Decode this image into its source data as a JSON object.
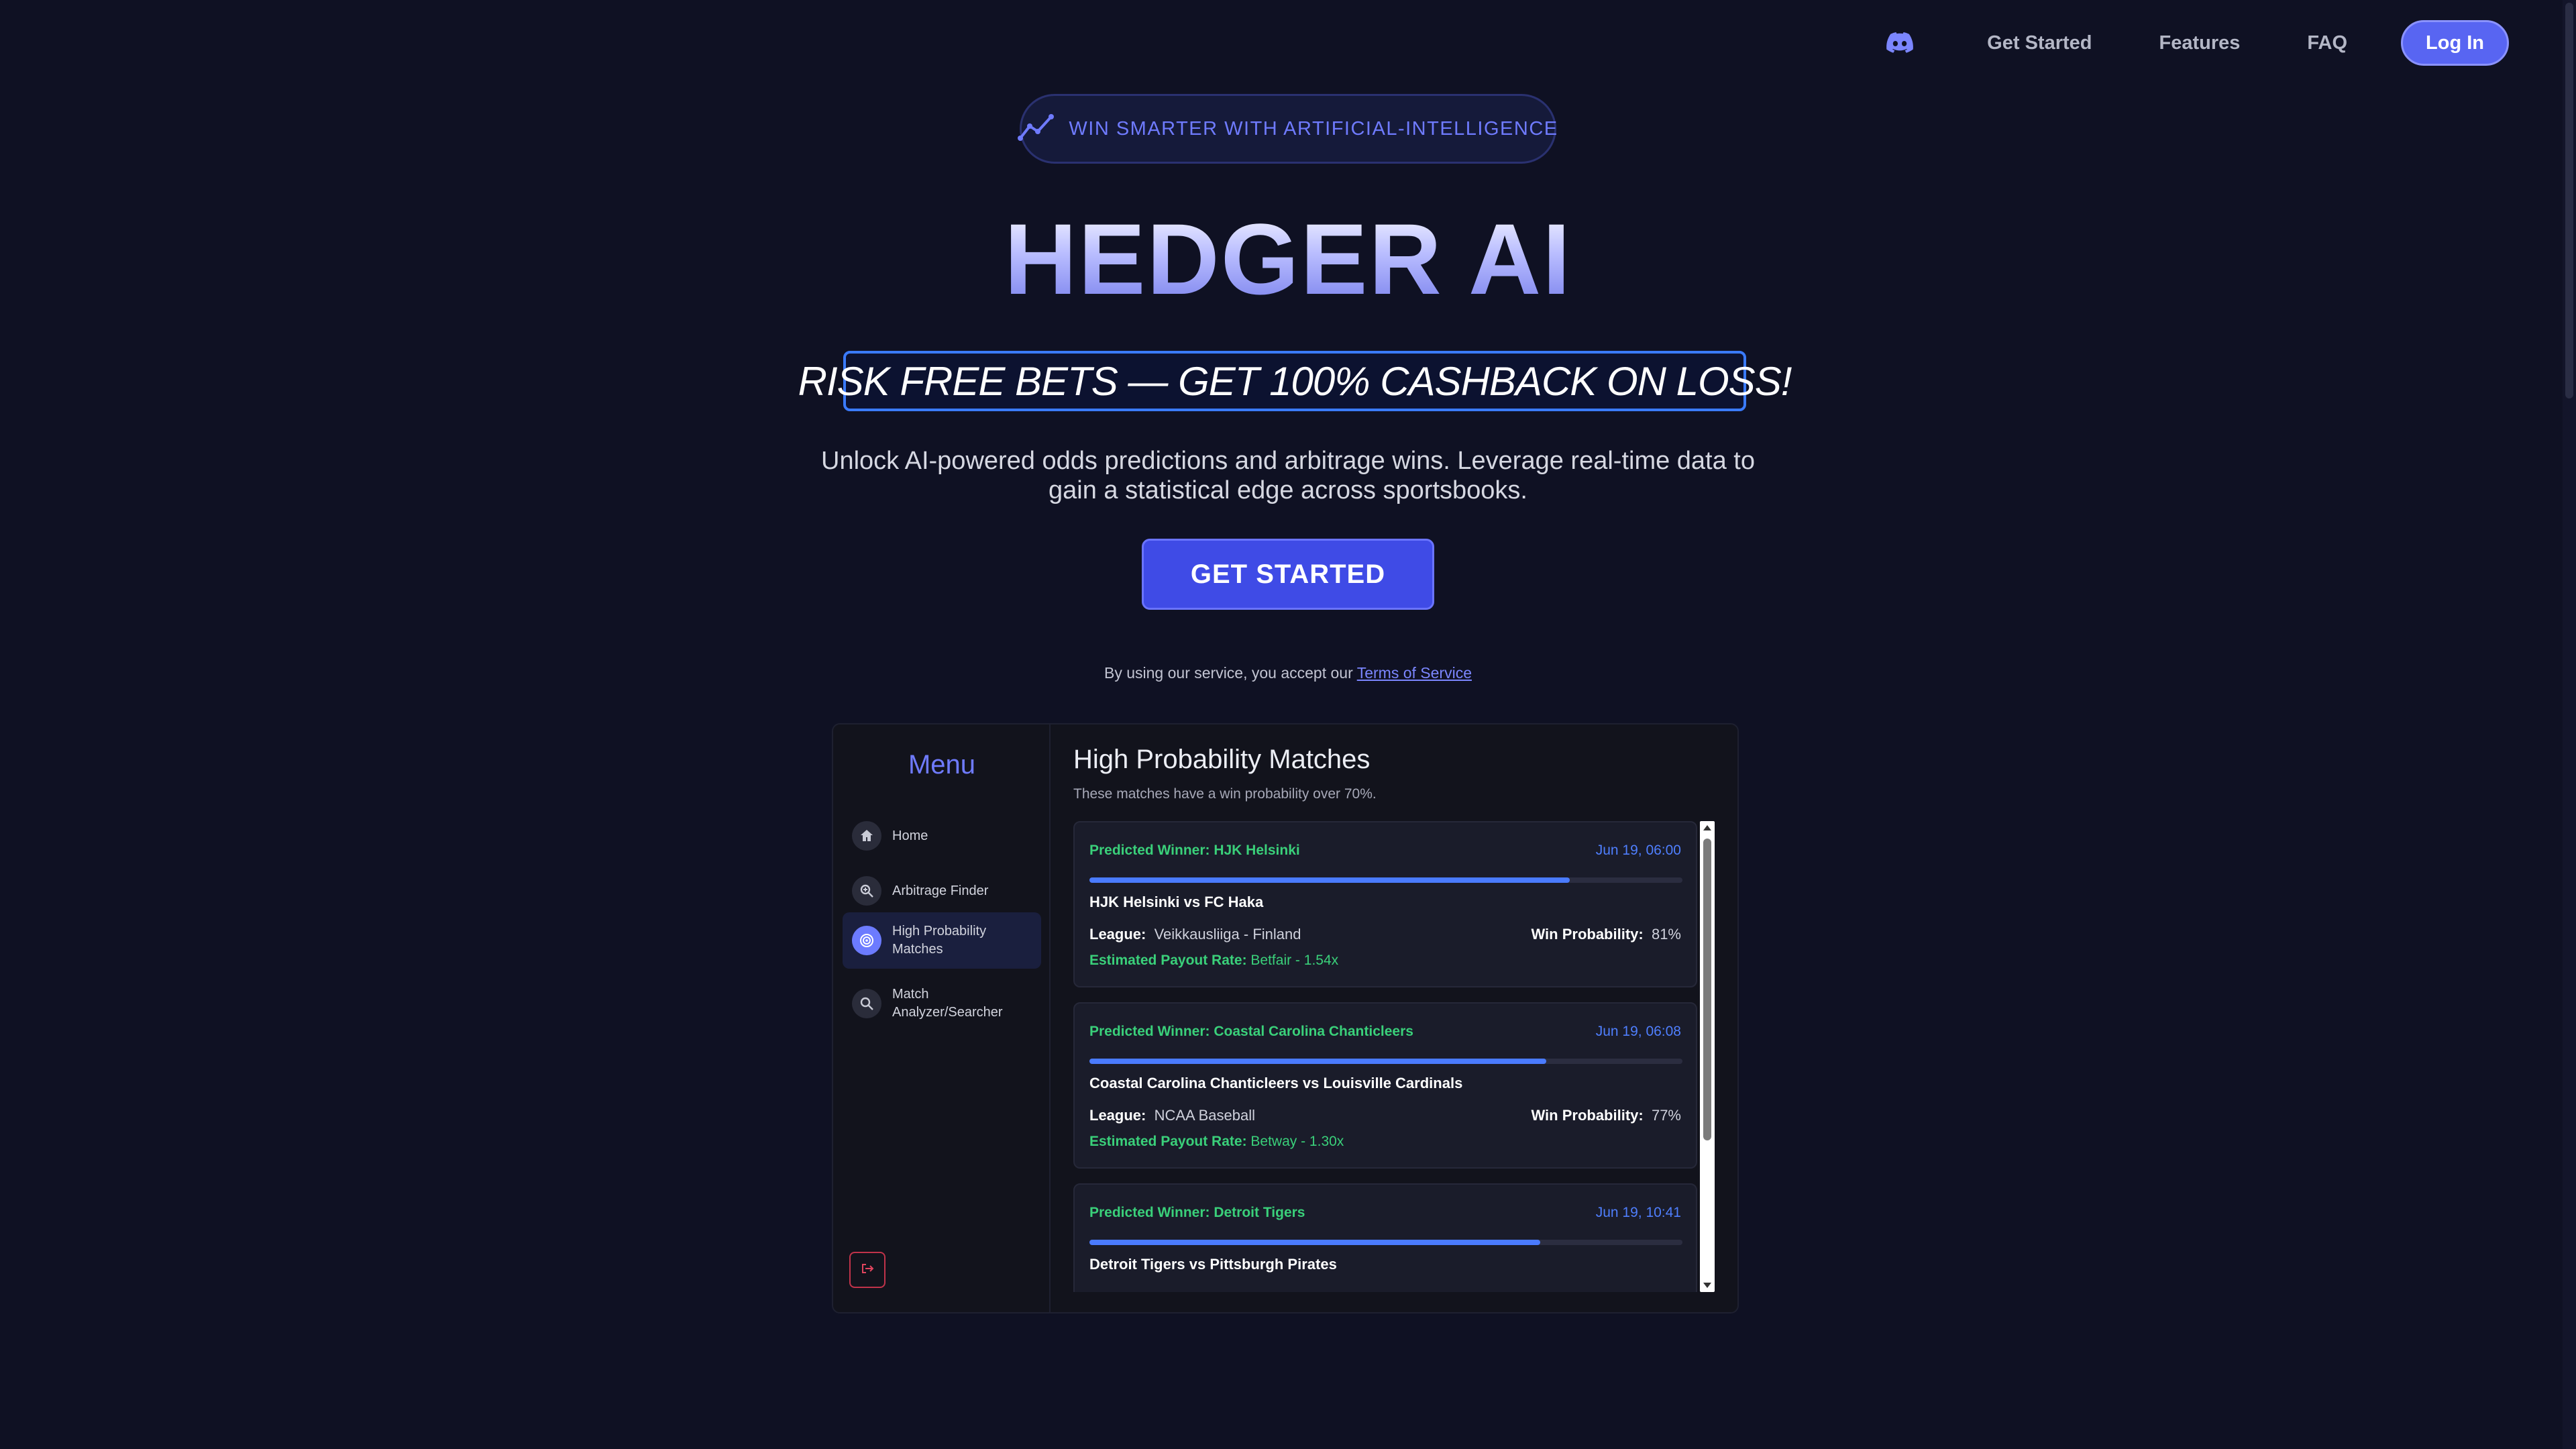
{
  "nav": {
    "discord_icon": "discord-icon",
    "items": [
      "Get Started",
      "Features",
      "FAQ"
    ],
    "login_label": "Log In"
  },
  "hero": {
    "badge_icon": "trend-line-icon",
    "badge_text": "WIN SMARTER WITH ARTIFICIAL-INTELLIGENCE",
    "title": "HEDGER AI",
    "risk_banner": "RISK FREE BETS — GET 100% CASHBACK ON LOSS!",
    "subtitle": "Unlock AI-powered odds predictions and arbitrage wins. Leverage real-time data to gain a statistical edge across sportsbooks.",
    "cta_label": "GET STARTED",
    "tos_prefix": "By using our service, you accept our ",
    "tos_link": "Terms of Service"
  },
  "preview": {
    "menu_title": "Menu",
    "menu_items": [
      {
        "label": "Home",
        "icon": "home-icon"
      },
      {
        "label": "Arbitrage Finder",
        "icon": "magnify-plus-icon"
      },
      {
        "label": "High Probability Matches",
        "icon": "target-icon",
        "active": true
      },
      {
        "label": "Match Analyzer/Searcher",
        "icon": "search-icon"
      }
    ],
    "logout_icon": "logout-icon",
    "heading": "High Probability Matches",
    "subheading": "These matches have a win probability over 70%.",
    "labels": {
      "league": "League:",
      "win_prob": "Win Probability:",
      "payout": "Estimated Payout Rate:"
    },
    "matches": [
      {
        "winner": "Predicted Winner: HJK Helsinki",
        "date": "Jun 19, 06:00",
        "progress": 0.81,
        "match": "HJK Helsinki vs FC Haka",
        "league": "Veikkausliiga - Finland",
        "win_prob": "81%",
        "payout": "Betfair - 1.54x"
      },
      {
        "winner": "Predicted Winner: Coastal Carolina Chanticleers",
        "date": "Jun 19, 06:08",
        "progress": 0.77,
        "match": "Coastal Carolina Chanticleers vs Louisville Cardinals",
        "league": "NCAA Baseball",
        "win_prob": "77%",
        "payout": "Betway - 1.30x"
      },
      {
        "winner": "Predicted Winner: Detroit Tigers",
        "date": "Jun 19, 10:41",
        "progress": 0.76,
        "match": "Detroit Tigers vs Pittsburgh Pirates",
        "league": "",
        "win_prob": "",
        "payout": ""
      }
    ]
  }
}
